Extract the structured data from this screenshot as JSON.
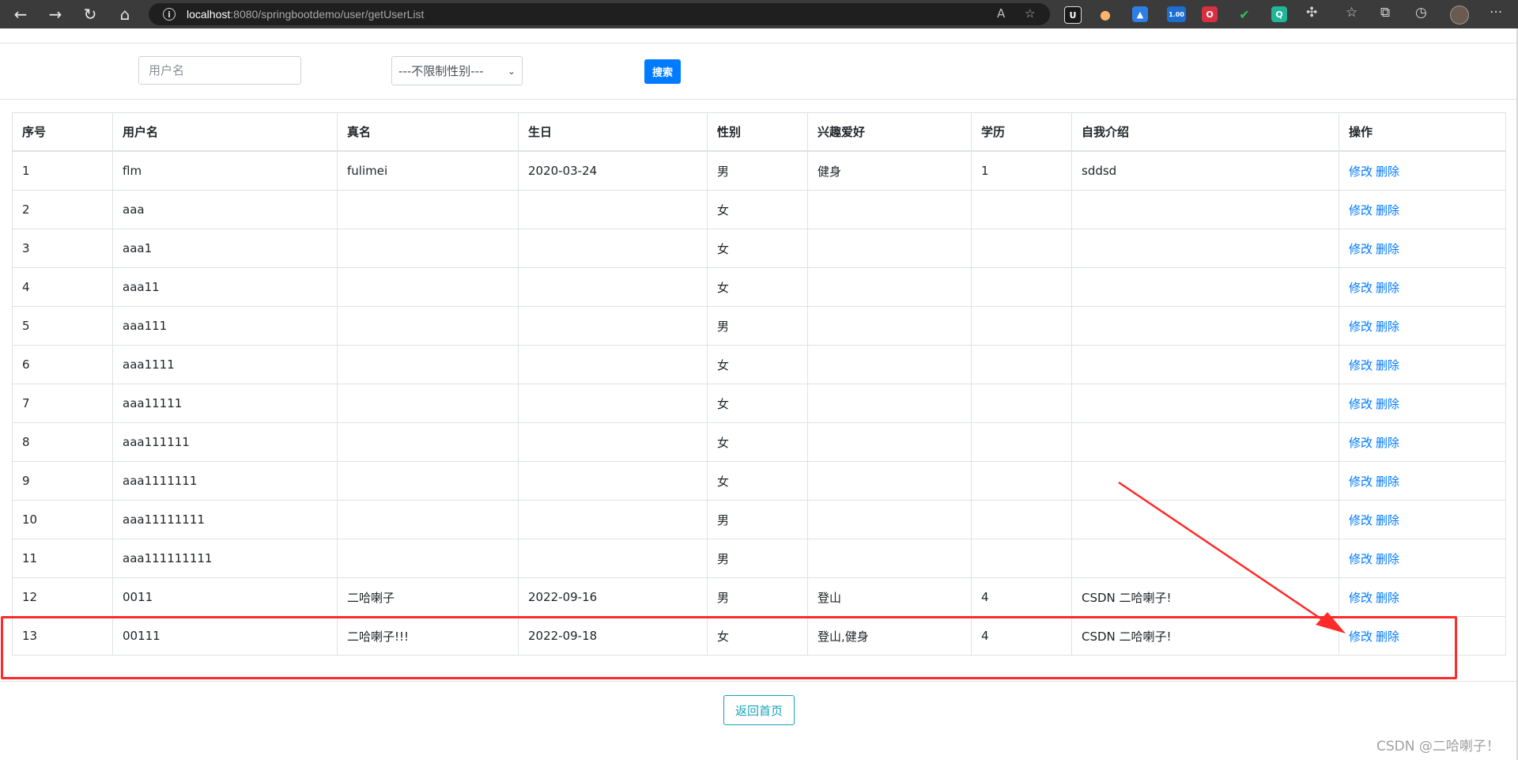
{
  "browser": {
    "url_host": "localhost",
    "url_path": ":8080/springbootdemo/user/getUserList",
    "extension_badge": "1.00"
  },
  "filter": {
    "username_placeholder": "用户名",
    "gender_selected": "---不限制性别---",
    "search_label": "搜索"
  },
  "table": {
    "headers": [
      "序号",
      "用户名",
      "真名",
      "生日",
      "性别",
      "兴趣爱好",
      "学历",
      "自我介绍",
      "操作"
    ],
    "edit_label": "修改",
    "delete_label": "删除",
    "rows": [
      {
        "id": "1",
        "username": "flm",
        "realname": "fulimei",
        "birthday": "2020-03-24",
        "gender": "男",
        "hobby": "健身",
        "education": "1",
        "intro": "sddsd"
      },
      {
        "id": "2",
        "username": "aaa",
        "realname": "",
        "birthday": "",
        "gender": "女",
        "hobby": "",
        "education": "",
        "intro": ""
      },
      {
        "id": "3",
        "username": "aaa1",
        "realname": "",
        "birthday": "",
        "gender": "女",
        "hobby": "",
        "education": "",
        "intro": ""
      },
      {
        "id": "4",
        "username": "aaa11",
        "realname": "",
        "birthday": "",
        "gender": "女",
        "hobby": "",
        "education": "",
        "intro": ""
      },
      {
        "id": "5",
        "username": "aaa111",
        "realname": "",
        "birthday": "",
        "gender": "男",
        "hobby": "",
        "education": "",
        "intro": ""
      },
      {
        "id": "6",
        "username": "aaa1111",
        "realname": "",
        "birthday": "",
        "gender": "女",
        "hobby": "",
        "education": "",
        "intro": ""
      },
      {
        "id": "7",
        "username": "aaa11111",
        "realname": "",
        "birthday": "",
        "gender": "女",
        "hobby": "",
        "education": "",
        "intro": ""
      },
      {
        "id": "8",
        "username": "aaa111111",
        "realname": "",
        "birthday": "",
        "gender": "女",
        "hobby": "",
        "education": "",
        "intro": ""
      },
      {
        "id": "9",
        "username": "aaa1111111",
        "realname": "",
        "birthday": "",
        "gender": "女",
        "hobby": "",
        "education": "",
        "intro": ""
      },
      {
        "id": "10",
        "username": "aaa11111111",
        "realname": "",
        "birthday": "",
        "gender": "男",
        "hobby": "",
        "education": "",
        "intro": ""
      },
      {
        "id": "11",
        "username": "aaa111111111",
        "realname": "",
        "birthday": "",
        "gender": "男",
        "hobby": "",
        "education": "",
        "intro": ""
      },
      {
        "id": "12",
        "username": "0011",
        "realname": "二哈喇子",
        "birthday": "2022-09-16",
        "gender": "男",
        "hobby": "登山",
        "education": "4",
        "intro": "CSDN 二哈喇子!"
      },
      {
        "id": "13",
        "username": "00111",
        "realname": "二哈喇子!!!",
        "birthday": "2022-09-18",
        "gender": "女",
        "hobby": "登山,健身",
        "education": "4",
        "intro": "CSDN 二哈喇子!"
      }
    ]
  },
  "home_button_label": "返回首页",
  "watermark": "CSDN @二哈喇子！",
  "colors": {
    "annotation_red": "#ff2a2a",
    "link_blue": "#007bff",
    "primary": "#007bff",
    "info": "#17a2b8"
  }
}
